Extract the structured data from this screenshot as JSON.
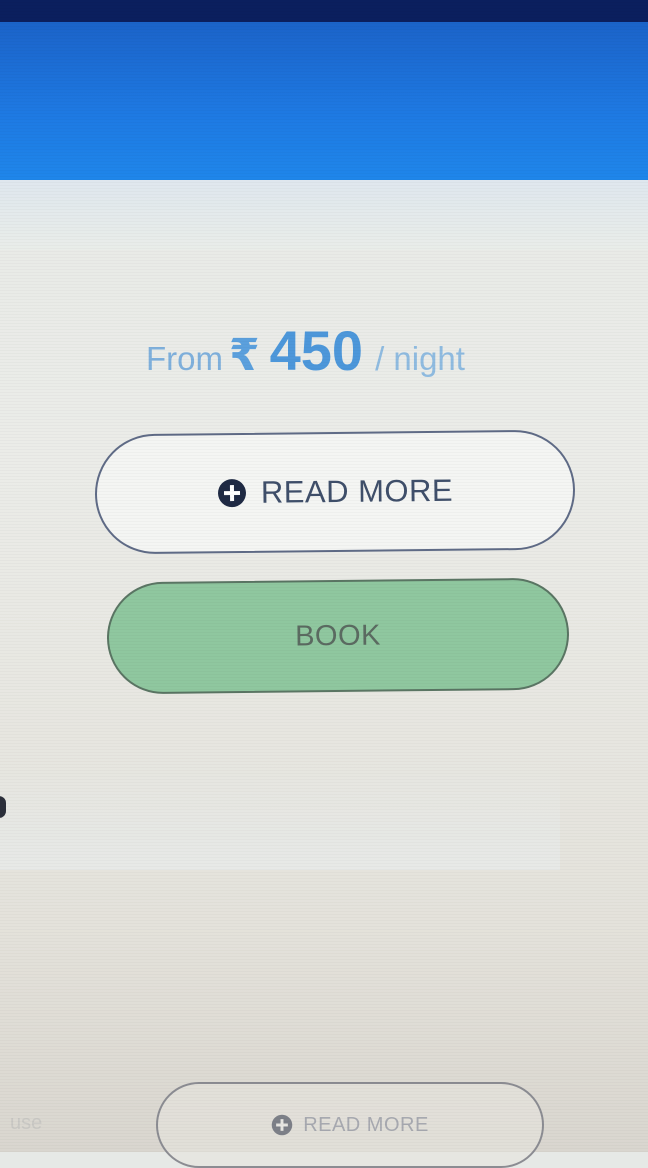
{
  "header": {
    "bar_color": "#1e7ae3"
  },
  "pricing": {
    "from_label": "From",
    "currency_symbol": "₹",
    "amount": "450",
    "unit_label": "/ night",
    "accent_color": "#4d97da"
  },
  "actions": {
    "read_more": {
      "icon": "plus-circle-icon",
      "label": "READ MORE"
    },
    "book": {
      "label": "BOOK",
      "color": "#8fc79f"
    }
  },
  "next_card": {
    "read_more": {
      "icon": "plus-circle-icon",
      "label": "READ MORE"
    },
    "partial_text": "use"
  }
}
